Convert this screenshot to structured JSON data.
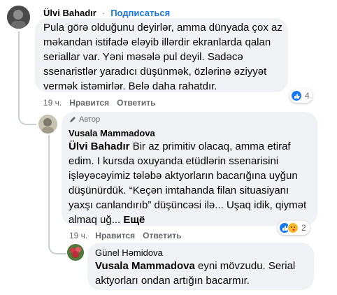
{
  "comment1": {
    "author": "Ülvi Bahadır",
    "subscribe": "Подписаться",
    "text": "Pula görə olduğunu deyirlər, amma dünyada çox az məkandan istifadə eləyib illərdir ekranlarda qalan seriallar var. Yəni məsələ pul deyil. Sadəcə ssenaristlər yaradıcı düşünmək, özlərinə əziyyət vermək istəmirlər. Belə daha rahatdır.",
    "time": "19 ч.",
    "like": "Нравится",
    "reply": "Ответить",
    "reaction_count": "4"
  },
  "comment2": {
    "author_badge": "Автор",
    "author": "Vusala Mammadova",
    "mention": "Ülvi Bahadır",
    "text_line1": " Bir az primitiv olacaq, amma etiraf",
    "text_rest": [
      "edim. I kursda oxuyanda etüdlərin ssenarisini",
      "işləyəcəyimiz tələbə aktyorların bacarığına uyğun",
      "düşünürdük. “Keçən imtahanda filan situasiyanı",
      "yaxşı canlandırıb” düşüncəsi ilə... Uşaq idik, qiymət"
    ],
    "text_last": "almaq uğ...",
    "more": "Ещё",
    "time": "19 ч.",
    "like": "Нравится",
    "reply": "Ответить",
    "reaction_count": "2"
  },
  "comment3": {
    "author": "Günel Həmidova",
    "mention": "Vusala Mammadova",
    "text_line1": " eyni mövzudu. Serial",
    "text_line2": "aktyorları ondan artığın bacarmır."
  },
  "colors": {
    "link": "#1b74e4",
    "like_blue": "#1877f2",
    "haha_yellow": "#f7b928"
  }
}
